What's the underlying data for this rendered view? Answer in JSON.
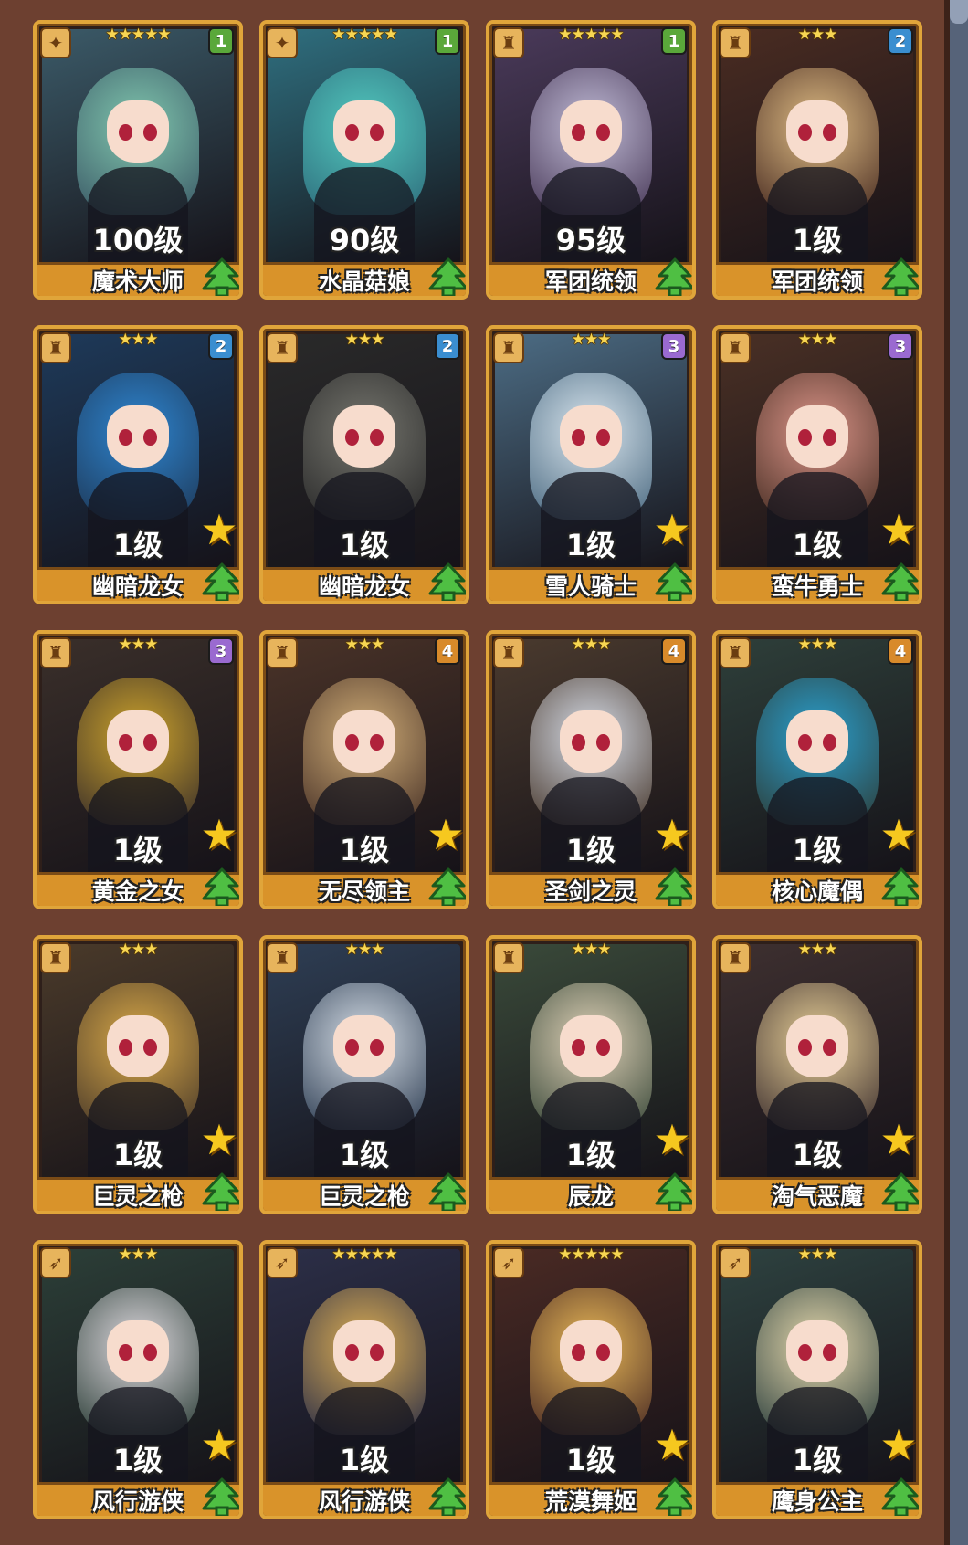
{
  "ui": {
    "rank_colors": {
      "1": "#5aa83a",
      "2": "#3a8ed0",
      "3": "#9a6ad0",
      "4": "#d88a2a"
    },
    "class_icons": {
      "wand": "wand-icon",
      "horn": "horn-icon",
      "bow": "bow-icon"
    }
  },
  "cards": [
    {
      "name": "魔术大师",
      "level": "100级",
      "stars": "★★★★★",
      "rank": "1",
      "class_icon": "wand-icon",
      "class_glyph": "✦",
      "awaken_star": false,
      "palette": [
        "#3b5a68",
        "#86cfb4"
      ]
    },
    {
      "name": "水晶菇娘",
      "level": "90级",
      "stars": "★★★★★",
      "rank": "1",
      "class_icon": "wand-icon",
      "class_glyph": "✦",
      "awaken_star": false,
      "palette": [
        "#2f6f7f",
        "#55d0c4"
      ]
    },
    {
      "name": "军团统领",
      "level": "95级",
      "stars": "★★★★★",
      "rank": "1",
      "class_icon": "horn-icon",
      "class_glyph": "♜",
      "awaken_star": false,
      "palette": [
        "#4a3a5a",
        "#c8c3de"
      ]
    },
    {
      "name": "军团统领",
      "level": "1级",
      "stars": "★★★",
      "rank": "2",
      "class_icon": "horn-icon",
      "class_glyph": "♜",
      "awaken_star": false,
      "palette": [
        "#4a2c22",
        "#e8c58a"
      ]
    },
    {
      "name": "幽暗龙女",
      "level": "1级",
      "stars": "★★★",
      "rank": "2",
      "class_icon": "horn-icon",
      "class_glyph": "♜",
      "awaken_star": true,
      "palette": [
        "#1e3a5a",
        "#2f8ad8"
      ]
    },
    {
      "name": "幽暗龙女",
      "level": "1级",
      "stars": "★★★",
      "rank": "2",
      "class_icon": "horn-icon",
      "class_glyph": "♜",
      "awaken_star": false,
      "palette": [
        "#2a2a2a",
        "#7a7a72"
      ]
    },
    {
      "name": "雪人骑士",
      "level": "1级",
      "stars": "★★★",
      "rank": "3",
      "class_icon": "horn-icon",
      "class_glyph": "♜",
      "awaken_star": true,
      "palette": [
        "#4c6c84",
        "#e2eef6"
      ]
    },
    {
      "name": "蛮牛勇士",
      "level": "1级",
      "stars": "★★★",
      "rank": "3",
      "class_icon": "horn-icon",
      "class_glyph": "♜",
      "awaken_star": true,
      "palette": [
        "#4a3025",
        "#e49a8e"
      ]
    },
    {
      "name": "黄金之女",
      "level": "1级",
      "stars": "★★★",
      "rank": "3",
      "class_icon": "horn-icon",
      "class_glyph": "♜",
      "awaken_star": true,
      "palette": [
        "#3a2f2a",
        "#d8ac2c"
      ]
    },
    {
      "name": "无尽领主",
      "level": "1级",
      "stars": "★★★",
      "rank": "4",
      "class_icon": "horn-icon",
      "class_glyph": "♜",
      "awaken_star": true,
      "palette": [
        "#4a3328",
        "#d9b57c"
      ]
    },
    {
      "name": "圣剑之灵",
      "level": "1级",
      "stars": "★★★",
      "rank": "4",
      "class_icon": "horn-icon",
      "class_glyph": "♜",
      "awaken_star": true,
      "palette": [
        "#4a3a2e",
        "#dfe6f2"
      ]
    },
    {
      "name": "核心魔偶",
      "level": "1级",
      "stars": "★★★",
      "rank": "4",
      "class_icon": "horn-icon",
      "class_glyph": "♜",
      "awaken_star": true,
      "palette": [
        "#2e3f3a",
        "#2aa6d8"
      ]
    },
    {
      "name": "巨灵之枪",
      "level": "1级",
      "stars": "★★★",
      "rank": "",
      "class_icon": "horn-icon",
      "class_glyph": "♜",
      "awaken_star": true,
      "palette": [
        "#4a3a2a",
        "#e2b04a"
      ]
    },
    {
      "name": "巨灵之枪",
      "level": "1级",
      "stars": "★★★",
      "rank": "",
      "class_icon": "horn-icon",
      "class_glyph": "♜",
      "awaken_star": false,
      "palette": [
        "#2e3e54",
        "#dfe7ef"
      ]
    },
    {
      "name": "辰龙",
      "level": "1级",
      "stars": "★★★",
      "rank": "",
      "class_icon": "horn-icon",
      "class_glyph": "♜",
      "awaken_star": true,
      "palette": [
        "#3a4a3a",
        "#e8d9be"
      ]
    },
    {
      "name": "淘气恶魔",
      "level": "1级",
      "stars": "★★★",
      "rank": "",
      "class_icon": "horn-icon",
      "class_glyph": "♜",
      "awaken_star": true,
      "palette": [
        "#3e3030",
        "#f0d79c"
      ]
    },
    {
      "name": "风行游侠",
      "level": "1级",
      "stars": "★★★",
      "rank": "",
      "class_icon": "bow-icon",
      "class_glyph": "➶",
      "awaken_star": true,
      "palette": [
        "#2c3f38",
        "#e8e2e8"
      ]
    },
    {
      "name": "风行游侠",
      "level": "1级",
      "stars": "★★★★★",
      "rank": "",
      "class_icon": "bow-icon",
      "class_glyph": "➶",
      "awaken_star": false,
      "palette": [
        "#2c2f48",
        "#e9b755"
      ]
    },
    {
      "name": "荒漠舞姬",
      "level": "1级",
      "stars": "★★★★★",
      "rank": "",
      "class_icon": "bow-icon",
      "class_glyph": "➶",
      "awaken_star": true,
      "palette": [
        "#4a2a24",
        "#f2c05a"
      ]
    },
    {
      "name": "鹰身公主",
      "level": "1级",
      "stars": "★★★",
      "rank": "",
      "class_icon": "bow-icon",
      "class_glyph": "➶",
      "awaken_star": true,
      "palette": [
        "#2e4240",
        "#efe0b2"
      ]
    }
  ]
}
